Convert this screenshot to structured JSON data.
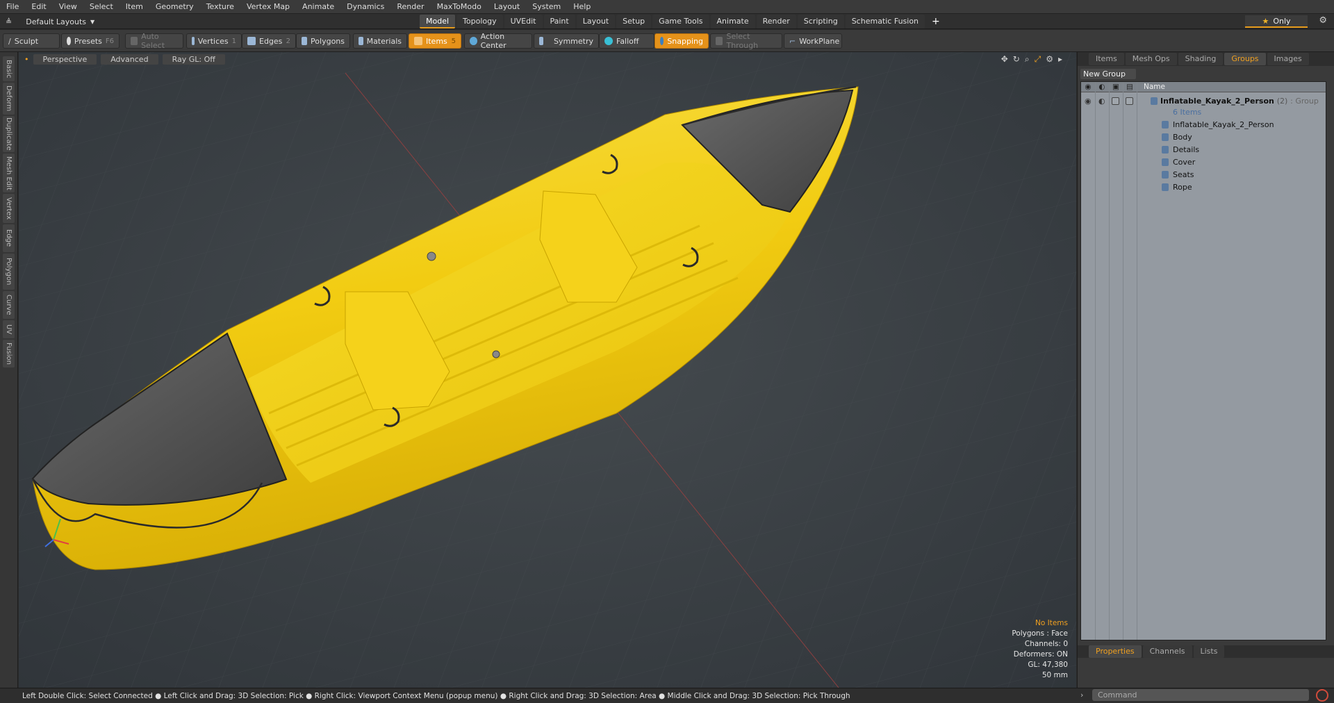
{
  "menu": [
    "File",
    "Edit",
    "View",
    "Select",
    "Item",
    "Geometry",
    "Texture",
    "Vertex Map",
    "Animate",
    "Dynamics",
    "Render",
    "MaxToModo",
    "Layout",
    "System",
    "Help"
  ],
  "layout_selector": "Default Layouts",
  "layout_tabs": [
    "Model",
    "Topology",
    "UVEdit",
    "Paint",
    "Layout",
    "Setup",
    "Game Tools",
    "Animate",
    "Render",
    "Scripting",
    "Schematic Fusion"
  ],
  "active_layout_tab": "Model",
  "only_label": "Only",
  "toolbar": {
    "sculpt": "Sculpt",
    "presets": "Presets",
    "presets_key": "F6",
    "auto_select": "Auto Select",
    "vertices": "Vertices",
    "vertices_key": "1",
    "edges": "Edges",
    "edges_key": "2",
    "polygons": "Polygons",
    "materials": "Materials",
    "items": "Items",
    "items_key": "5",
    "action_center": "Action Center",
    "symmetry": "Symmetry",
    "falloff": "Falloff",
    "snapping": "Snapping",
    "select_through": "Select Through",
    "workplane": "WorkPlane"
  },
  "left_tabs": [
    "Basic",
    "Deform",
    "Duplicate",
    "Mesh Edit",
    "Vertex",
    "Edge",
    "Polygon",
    "Curve",
    "UV",
    "Fusion"
  ],
  "viewport": {
    "view_mode": "Perspective",
    "shading": "Advanced",
    "raygl": "Ray GL: Off",
    "hud": {
      "no_items": "No Items",
      "polygons": "Polygons : Face",
      "channels": "Channels: 0",
      "deformers": "Deformers: ON",
      "gl": "GL: 47,380",
      "scale": "50 mm"
    }
  },
  "panel": {
    "tabs": [
      "Items",
      "Mesh Ops",
      "Shading",
      "Groups",
      "Images"
    ],
    "active_tab": "Groups",
    "new_group": "New Group",
    "name_header": "Name",
    "group": {
      "name": "Inflatable_Kayak_2_Person",
      "count": "(2)",
      "type": ": Group",
      "items_count": "6 Items"
    },
    "children": [
      "Inflatable_Kayak_2_Person",
      "Body",
      "Details",
      "Cover",
      "Seats",
      "Rope"
    ],
    "bottom_tabs": [
      "Properties",
      "Channels",
      "Lists"
    ],
    "active_bottom_tab": "Properties"
  },
  "status": "Left Double Click: Select Connected ● Left Click and Drag: 3D Selection: Pick ● Right Click: Viewport Context Menu (popup menu) ● Right Click and Drag: 3D Selection: Area ● Middle Click and Drag: 3D Selection: Pick Through",
  "command_placeholder": "Command",
  "colors": {
    "accent": "#e5921a",
    "kayak": "#f2d21a",
    "cover": "#5a5a5a"
  }
}
